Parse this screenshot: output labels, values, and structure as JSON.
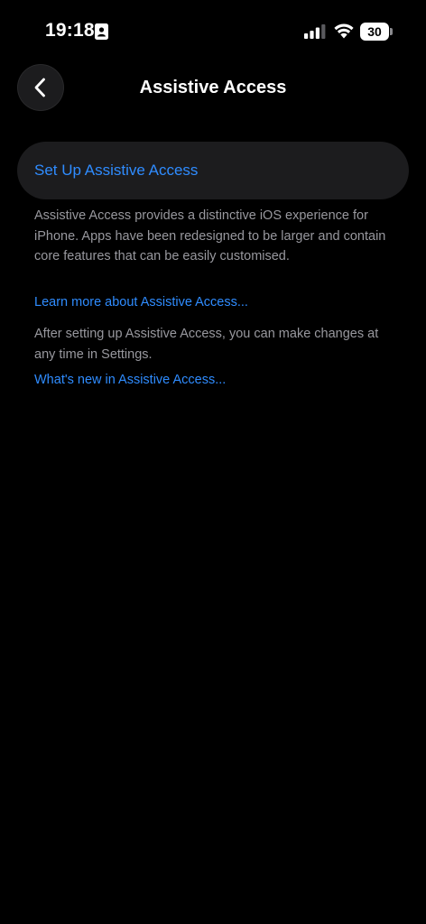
{
  "status_bar": {
    "time": "19:18",
    "battery_level": "30",
    "icons": [
      "id-card-icon",
      "signal-icon",
      "wifi-icon",
      "battery-icon"
    ]
  },
  "nav": {
    "title": "Assistive Access",
    "back_icon": "chevron-left-icon"
  },
  "setup": {
    "label": "Set Up Assistive Access"
  },
  "content": {
    "description": "Assistive Access provides a distinctive iOS experience for iPhone. Apps have been redesigned to be larger and contain core features that can be easily customised.",
    "learn_more_link": "Learn more about Assistive Access...",
    "after_setup_text": "After setting up Assistive Access, you can make changes at any time in Settings.",
    "whats_new_link": "What's new in Assistive Access..."
  },
  "colors": {
    "background": "#000000",
    "row_background": "#1c1c1e",
    "accent_blue": "#2f8cff",
    "secondary_text": "#98989e"
  }
}
